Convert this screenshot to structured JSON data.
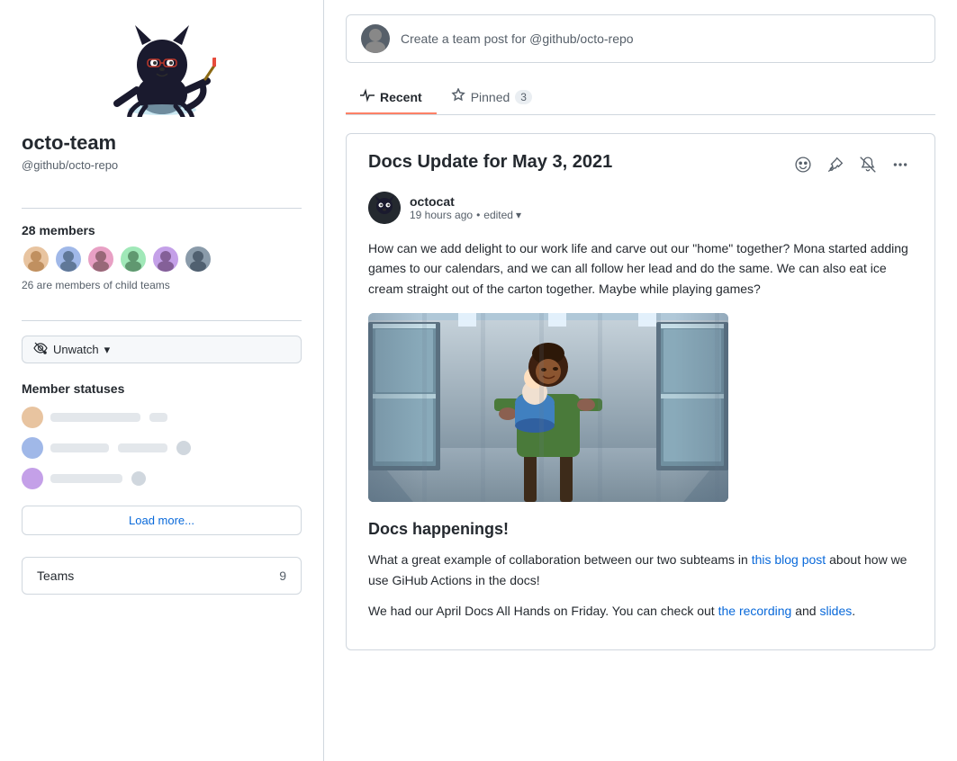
{
  "sidebar": {
    "team_name": "octo-team",
    "team_handle": "@github/octo-repo",
    "members_count": "28 members",
    "child_teams_text": "26 are members of child teams",
    "unwatch_label": "Unwatch",
    "member_statuses_title": "Member statuses",
    "load_more_label": "Load more...",
    "teams_section": {
      "label": "Teams",
      "count": "9"
    },
    "avatars": [
      {
        "id": 1,
        "color": "#e8c4a0"
      },
      {
        "id": 2,
        "color": "#a0b8e8"
      },
      {
        "id": 3,
        "color": "#e8a0c4"
      },
      {
        "id": 4,
        "color": "#a0e8b8"
      },
      {
        "id": 5,
        "color": "#c4a0e8"
      },
      {
        "id": 6,
        "color": "#8a9baa"
      }
    ],
    "member_statuses": [
      {
        "name_width": 80,
        "extra_width": 0,
        "has_emoji": false,
        "color": "#d0d7de"
      },
      {
        "name_width": 60,
        "extra_width": 55,
        "has_emoji": true,
        "color": "#d0d7de"
      },
      {
        "name_width": 70,
        "extra_width": 0,
        "has_emoji": true,
        "color": "#d0d7de"
      }
    ]
  },
  "main": {
    "create_post_placeholder": "Create a team post for @github/octo-repo",
    "tabs": [
      {
        "id": "recent",
        "label": "Recent",
        "active": true,
        "badge": null
      },
      {
        "id": "pinned",
        "label": "Pinned",
        "active": false,
        "badge": "3"
      }
    ],
    "post": {
      "title": "Docs Update for May 3, 2021",
      "author": "octocat",
      "timestamp": "19 hours ago",
      "edited_label": "edited",
      "body_text": "How can we add delight to our work life and carve out our \"home\" together? Mona started adding games to our calendars, and we can all follow her lead and do the same. We can also eat ice cream straight out of the carton together. Maybe while playing games?",
      "section_title": "Docs happenings!",
      "paragraph1_start": "What a great example of collaboration between our two subteams in ",
      "paragraph1_link": "this blog post",
      "paragraph1_end": " about how we use GiHub Actions in the docs!",
      "paragraph2_start": "We had our April Docs All Hands on Friday. You can check out ",
      "paragraph2_link1": "the recording",
      "paragraph2_mid": " and ",
      "paragraph2_link2": "slides",
      "paragraph2_end": "."
    }
  },
  "icons": {
    "pulse_icon": "↗",
    "star_icon": "☆",
    "bell_icon": "🔔",
    "more_icon": "···",
    "eye_icon": "👁",
    "chevron_down": "▾"
  }
}
